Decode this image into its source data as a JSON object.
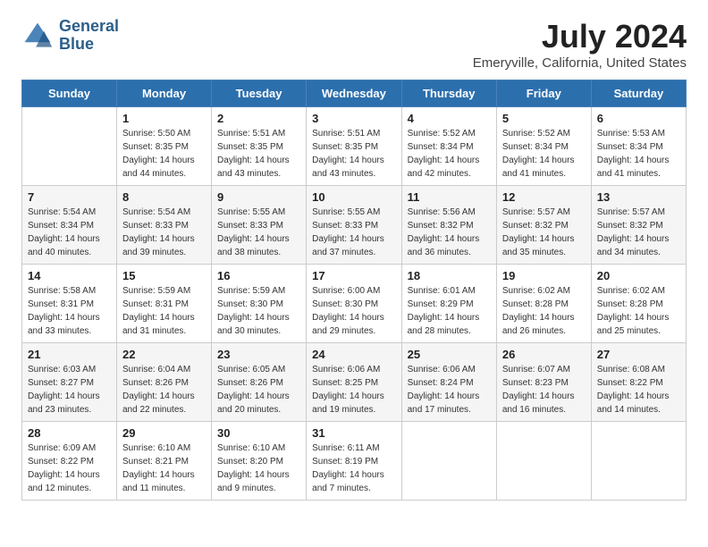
{
  "header": {
    "logo_line1": "General",
    "logo_line2": "Blue",
    "month_title": "July 2024",
    "location": "Emeryville, California, United States"
  },
  "weekdays": [
    "Sunday",
    "Monday",
    "Tuesday",
    "Wednesday",
    "Thursday",
    "Friday",
    "Saturday"
  ],
  "weeks": [
    [
      {
        "day": "",
        "info": ""
      },
      {
        "day": "1",
        "info": "Sunrise: 5:50 AM\nSunset: 8:35 PM\nDaylight: 14 hours\nand 44 minutes."
      },
      {
        "day": "2",
        "info": "Sunrise: 5:51 AM\nSunset: 8:35 PM\nDaylight: 14 hours\nand 43 minutes."
      },
      {
        "day": "3",
        "info": "Sunrise: 5:51 AM\nSunset: 8:35 PM\nDaylight: 14 hours\nand 43 minutes."
      },
      {
        "day": "4",
        "info": "Sunrise: 5:52 AM\nSunset: 8:34 PM\nDaylight: 14 hours\nand 42 minutes."
      },
      {
        "day": "5",
        "info": "Sunrise: 5:52 AM\nSunset: 8:34 PM\nDaylight: 14 hours\nand 41 minutes."
      },
      {
        "day": "6",
        "info": "Sunrise: 5:53 AM\nSunset: 8:34 PM\nDaylight: 14 hours\nand 41 minutes."
      }
    ],
    [
      {
        "day": "7",
        "info": "Sunrise: 5:54 AM\nSunset: 8:34 PM\nDaylight: 14 hours\nand 40 minutes."
      },
      {
        "day": "8",
        "info": "Sunrise: 5:54 AM\nSunset: 8:33 PM\nDaylight: 14 hours\nand 39 minutes."
      },
      {
        "day": "9",
        "info": "Sunrise: 5:55 AM\nSunset: 8:33 PM\nDaylight: 14 hours\nand 38 minutes."
      },
      {
        "day": "10",
        "info": "Sunrise: 5:55 AM\nSunset: 8:33 PM\nDaylight: 14 hours\nand 37 minutes."
      },
      {
        "day": "11",
        "info": "Sunrise: 5:56 AM\nSunset: 8:32 PM\nDaylight: 14 hours\nand 36 minutes."
      },
      {
        "day": "12",
        "info": "Sunrise: 5:57 AM\nSunset: 8:32 PM\nDaylight: 14 hours\nand 35 minutes."
      },
      {
        "day": "13",
        "info": "Sunrise: 5:57 AM\nSunset: 8:32 PM\nDaylight: 14 hours\nand 34 minutes."
      }
    ],
    [
      {
        "day": "14",
        "info": "Sunrise: 5:58 AM\nSunset: 8:31 PM\nDaylight: 14 hours\nand 33 minutes."
      },
      {
        "day": "15",
        "info": "Sunrise: 5:59 AM\nSunset: 8:31 PM\nDaylight: 14 hours\nand 31 minutes."
      },
      {
        "day": "16",
        "info": "Sunrise: 5:59 AM\nSunset: 8:30 PM\nDaylight: 14 hours\nand 30 minutes."
      },
      {
        "day": "17",
        "info": "Sunrise: 6:00 AM\nSunset: 8:30 PM\nDaylight: 14 hours\nand 29 minutes."
      },
      {
        "day": "18",
        "info": "Sunrise: 6:01 AM\nSunset: 8:29 PM\nDaylight: 14 hours\nand 28 minutes."
      },
      {
        "day": "19",
        "info": "Sunrise: 6:02 AM\nSunset: 8:28 PM\nDaylight: 14 hours\nand 26 minutes."
      },
      {
        "day": "20",
        "info": "Sunrise: 6:02 AM\nSunset: 8:28 PM\nDaylight: 14 hours\nand 25 minutes."
      }
    ],
    [
      {
        "day": "21",
        "info": "Sunrise: 6:03 AM\nSunset: 8:27 PM\nDaylight: 14 hours\nand 23 minutes."
      },
      {
        "day": "22",
        "info": "Sunrise: 6:04 AM\nSunset: 8:26 PM\nDaylight: 14 hours\nand 22 minutes."
      },
      {
        "day": "23",
        "info": "Sunrise: 6:05 AM\nSunset: 8:26 PM\nDaylight: 14 hours\nand 20 minutes."
      },
      {
        "day": "24",
        "info": "Sunrise: 6:06 AM\nSunset: 8:25 PM\nDaylight: 14 hours\nand 19 minutes."
      },
      {
        "day": "25",
        "info": "Sunrise: 6:06 AM\nSunset: 8:24 PM\nDaylight: 14 hours\nand 17 minutes."
      },
      {
        "day": "26",
        "info": "Sunrise: 6:07 AM\nSunset: 8:23 PM\nDaylight: 14 hours\nand 16 minutes."
      },
      {
        "day": "27",
        "info": "Sunrise: 6:08 AM\nSunset: 8:22 PM\nDaylight: 14 hours\nand 14 minutes."
      }
    ],
    [
      {
        "day": "28",
        "info": "Sunrise: 6:09 AM\nSunset: 8:22 PM\nDaylight: 14 hours\nand 12 minutes."
      },
      {
        "day": "29",
        "info": "Sunrise: 6:10 AM\nSunset: 8:21 PM\nDaylight: 14 hours\nand 11 minutes."
      },
      {
        "day": "30",
        "info": "Sunrise: 6:10 AM\nSunset: 8:20 PM\nDaylight: 14 hours\nand 9 minutes."
      },
      {
        "day": "31",
        "info": "Sunrise: 6:11 AM\nSunset: 8:19 PM\nDaylight: 14 hours\nand 7 minutes."
      },
      {
        "day": "",
        "info": ""
      },
      {
        "day": "",
        "info": ""
      },
      {
        "day": "",
        "info": ""
      }
    ]
  ]
}
